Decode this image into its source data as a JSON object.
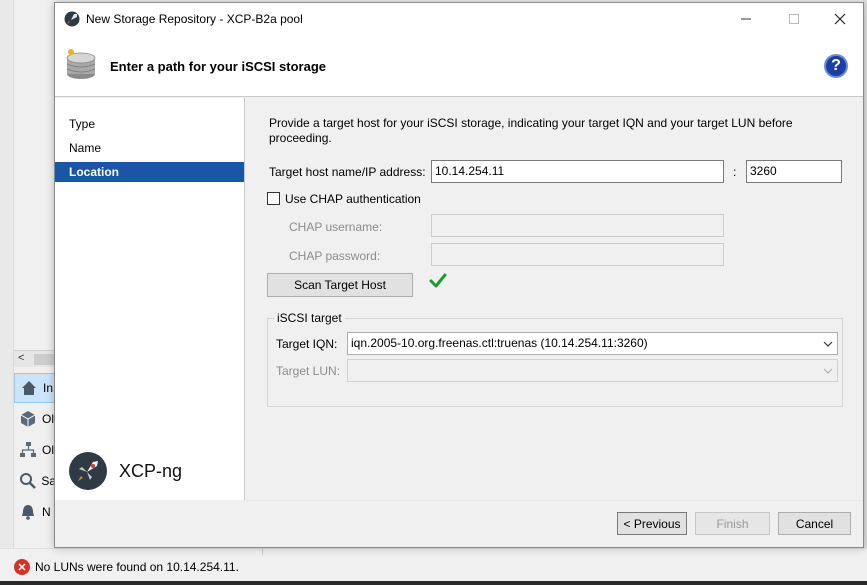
{
  "dialog": {
    "title": "New Storage Repository - XCP-B2a pool",
    "header_title": "Enter a path for your iSCSI storage",
    "help_label": "?",
    "steps": [
      {
        "label": "Type"
      },
      {
        "label": "Name"
      },
      {
        "label": "Location"
      }
    ],
    "brand": "XCP-ng",
    "intro": "Provide a target host for your iSCSI storage, indicating your target IQN and your target LUN before proceeding.",
    "target_host_label": "Target host name/IP address:",
    "target_host_value": "10.14.254.11",
    "port_separator": ":",
    "port_value": "3260",
    "chap_label": "Use CHAP authentication",
    "chap_checked": false,
    "chap_username_label": "CHAP username:",
    "chap_password_label": "CHAP password:",
    "scan_button": "Scan Target Host",
    "scan_status_icon": "check-icon",
    "iscsi_group_title": "iSCSI target",
    "target_iqn_label": "Target IQN:",
    "target_iqn_value": "iqn.2005-10.org.freenas.ctl:truenas (10.14.254.11:3260)",
    "target_lun_label": "Target LUN:",
    "target_lun_value": "",
    "previous_button": "< Previous",
    "finish_button": "Finish",
    "cancel_button": "Cancel"
  },
  "background": {
    "nav_items": [
      {
        "label": "In",
        "icon": "home-icon"
      },
      {
        "label": "Ol",
        "icon": "box-icon"
      },
      {
        "label": "Ol",
        "icon": "tree-icon"
      },
      {
        "label": "Sa",
        "icon": "search-icon"
      },
      {
        "label": "N",
        "icon": "bell-icon"
      }
    ],
    "scroll_left_arrow": "<",
    "status_message": "No LUNs were found on 10.14.254.11.",
    "status_icon_glyph": "✕"
  },
  "colors": {
    "selection": "#1a56a6",
    "checkmark": "#1e9b2e",
    "error": "#d93025",
    "help": "#1a3fa0"
  }
}
